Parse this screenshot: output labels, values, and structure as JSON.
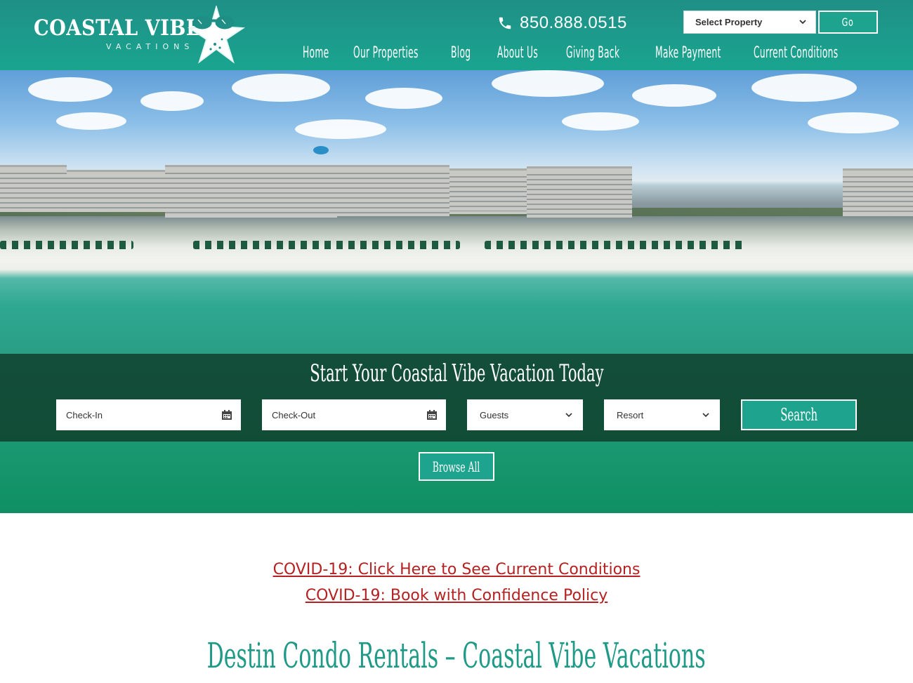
{
  "header": {
    "logo_text": "COASTAL VIBE",
    "logo_subtext": "VACATIONS",
    "phone": "850.888.0515",
    "property_select": {
      "selected": "Select Property"
    },
    "go_label": "Go",
    "nav": [
      "Home",
      "Our Properties",
      "Blog",
      "About Us",
      "Giving Back",
      "Make Payment",
      "Current Conditions"
    ]
  },
  "hero": {
    "search_title": "Start Your Coastal Vibe Vacation Today",
    "fields": {
      "checkin_placeholder": "Check-In",
      "checkout_placeholder": "Check-Out",
      "guests_selected": "Guests",
      "resort_selected": "Resort"
    },
    "search_label": "Search",
    "browse_label": "Browse All"
  },
  "content": {
    "covid_link_1": "COVID-19: Click Here to See Current Conditions",
    "covid_link_2": "COVID-19: Book with Confidence Policy",
    "page_title": "Destin Condo Rentals – Coastal Vibe Vacations"
  },
  "colors": {
    "brand_teal": "#1ea48e",
    "link_red": "#b52121"
  },
  "icons": [
    "phone-icon",
    "starfish-sunglasses-logo",
    "chevron-down-icon",
    "calendar-icon"
  ]
}
